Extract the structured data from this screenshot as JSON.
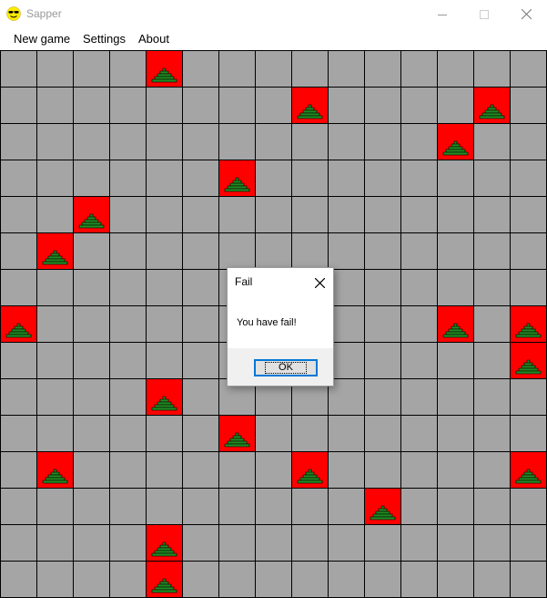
{
  "window": {
    "title": "Sapper",
    "icon": "smiley-sunglasses-icon"
  },
  "menu": [
    {
      "label": "New game"
    },
    {
      "label": "Settings"
    },
    {
      "label": "About"
    }
  ],
  "board": {
    "columns": 15,
    "rows": 15,
    "cell_color": "#a5a5a5",
    "mine_cell_color": "#ff0000",
    "mine_color": "#228b22",
    "mines": [
      [
        0,
        4
      ],
      [
        1,
        8
      ],
      [
        1,
        13
      ],
      [
        2,
        12
      ],
      [
        3,
        6
      ],
      [
        4,
        2
      ],
      [
        5,
        1
      ],
      [
        7,
        0
      ],
      [
        7,
        12
      ],
      [
        7,
        14
      ],
      [
        8,
        14
      ],
      [
        9,
        4
      ],
      [
        10,
        6
      ],
      [
        11,
        1
      ],
      [
        11,
        8
      ],
      [
        11,
        14
      ],
      [
        12,
        10
      ],
      [
        13,
        4
      ],
      [
        14,
        4
      ]
    ]
  },
  "dialog": {
    "title": "Fail",
    "message": "You have fail!",
    "ok_label": "OK"
  }
}
